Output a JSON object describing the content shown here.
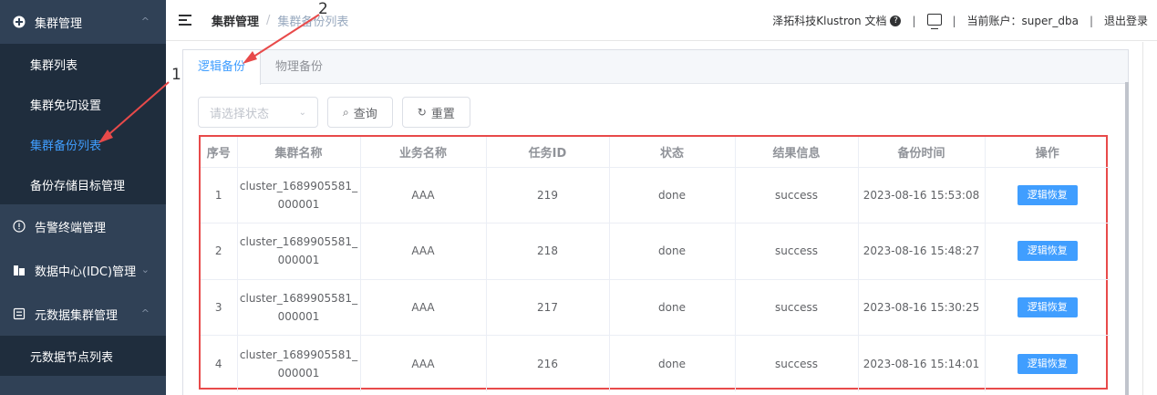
{
  "sidebar": {
    "groups": [
      {
        "label": "集群管理",
        "icon": "plus-circle-icon",
        "chev": "^"
      },
      {
        "label": "告警终端管理",
        "icon": "info-circle-icon"
      },
      {
        "label": "数据中心(IDC)管理",
        "icon": "building-icon",
        "chev": "⌄"
      },
      {
        "label": "元数据集群管理",
        "icon": "database-icon",
        "chev": "^"
      }
    ],
    "cluster_items": [
      "集群列表",
      "集群免切设置",
      "集群备份列表",
      "备份存储目标管理"
    ],
    "meta_items": [
      "元数据节点列表"
    ]
  },
  "header": {
    "breadcrumb_parent": "集群管理",
    "breadcrumb_sep": "/",
    "breadcrumb_current": "集群备份列表",
    "docs": "泽拓科技Klustron 文档",
    "help": "?",
    "sep": "|",
    "account": "当前账户：super_dba",
    "logout": "退出登录"
  },
  "tabs": [
    "逻辑备份",
    "物理备份"
  ],
  "filter": {
    "status_placeholder": "请选择状态",
    "chev": "⌄",
    "search_icon": "⌕",
    "search_label": "查询",
    "reset_icon": "↻",
    "reset_label": "重置"
  },
  "table": {
    "headers": [
      "序号",
      "集群名称",
      "业务名称",
      "任务ID",
      "状态",
      "结果信息",
      "备份时间",
      "操作"
    ],
    "rows": [
      {
        "no": "1",
        "cluster_a": "cluster_1689905581_",
        "cluster_b": "000001",
        "biz": "AAA",
        "task": "219",
        "status": "done",
        "result": "success",
        "time": "2023-08-16 15:53:08",
        "op": "逻辑恢复"
      },
      {
        "no": "2",
        "cluster_a": "cluster_1689905581_",
        "cluster_b": "000001",
        "biz": "AAA",
        "task": "218",
        "status": "done",
        "result": "success",
        "time": "2023-08-16 15:48:27",
        "op": "逻辑恢复"
      },
      {
        "no": "3",
        "cluster_a": "cluster_1689905581_",
        "cluster_b": "000001",
        "biz": "AAA",
        "task": "217",
        "status": "done",
        "result": "success",
        "time": "2023-08-16 15:30:25",
        "op": "逻辑恢复"
      },
      {
        "no": "4",
        "cluster_a": "cluster_1689905581_",
        "cluster_b": "000001",
        "biz": "AAA",
        "task": "216",
        "status": "done",
        "result": "success",
        "time": "2023-08-16 15:14:01",
        "op": "逻辑恢复"
      }
    ]
  },
  "annotations": {
    "one": "1",
    "two": "2"
  },
  "colors": {
    "accent": "#409eff",
    "sidebar": "#304156",
    "submenu": "#1f2d3d",
    "annotation": "#e84a4a"
  }
}
